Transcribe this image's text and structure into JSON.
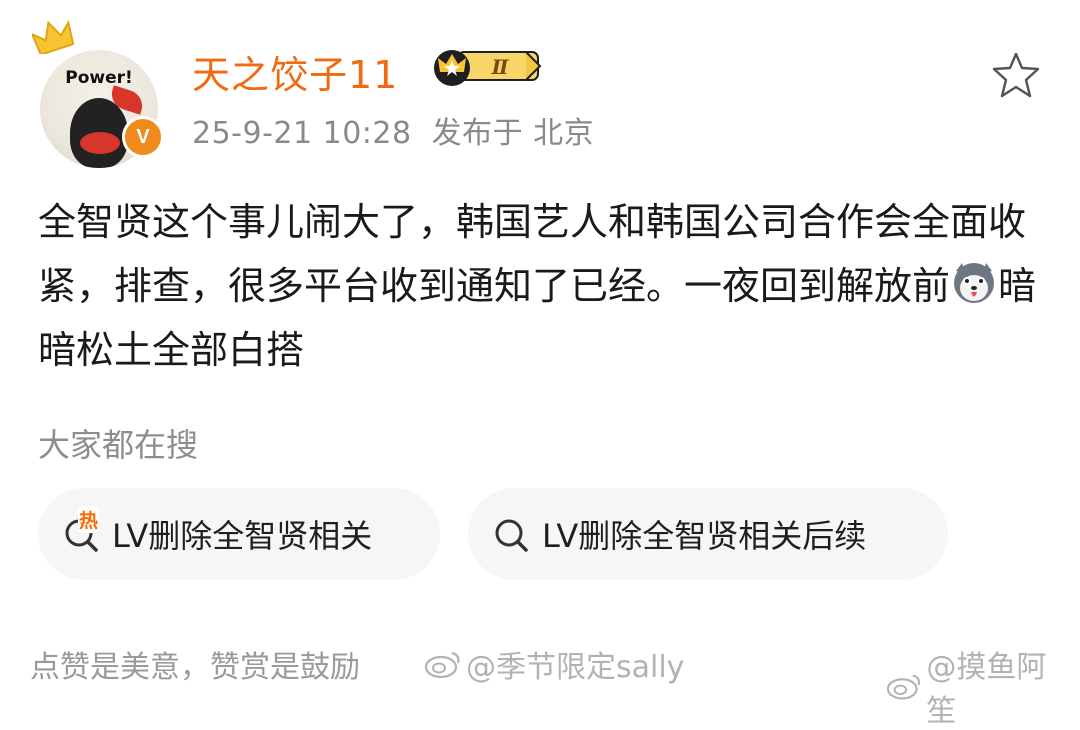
{
  "post": {
    "author": {
      "name": "天之饺子11",
      "avatar_text": "Power!",
      "verified_label": "V",
      "level_badge": "Ⅱ"
    },
    "time": "25-9-21 10:28",
    "location": "发布于 北京",
    "text_part1": "全智贤这个事儿闹大了，韩国艺人和韩国公司合作会全面收紧，排查，很多平台收到通知了已经。一夜回到解放前",
    "text_emoji": "husky-emoji",
    "text_part2": "暗暗松土全部白搭"
  },
  "search_section": {
    "title": "大家都在搜",
    "items": [
      {
        "label": "LV删除全智贤相关",
        "hot_label": "热",
        "icon": "search-hot-icon"
      },
      {
        "label": "LV删除全智贤相关后续",
        "icon": "search-icon"
      }
    ]
  },
  "footer": {
    "text": "点赞是美意，赞赏是鼓励",
    "watermarks": [
      "@季节限定sally",
      "@摸鱼阿笙"
    ]
  },
  "colors": {
    "username": "#f06a11",
    "verified": "#f08a1c",
    "hot": "#ff6a00",
    "meta_text": "#8a8a8a"
  }
}
